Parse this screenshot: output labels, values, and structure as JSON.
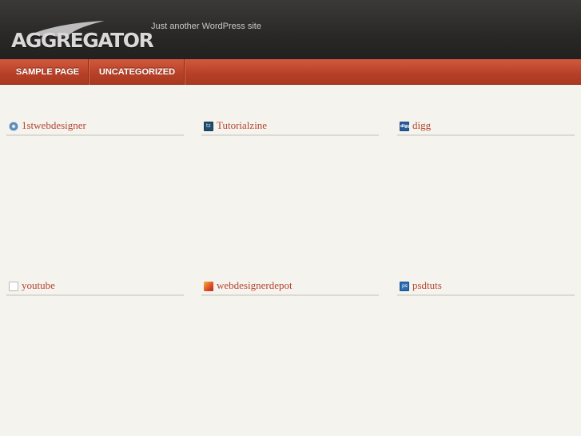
{
  "header": {
    "logo_text": "AGGREGATOR",
    "tagline": "Just another WordPress site"
  },
  "nav": {
    "items": [
      {
        "label": "SAMPLE PAGE"
      },
      {
        "label": "UNCATEGORIZED"
      }
    ]
  },
  "feeds": [
    {
      "title": "1stwebdesigner",
      "icon": "1stwebdesigner-icon"
    },
    {
      "title": "Tutorialzine",
      "icon": "tutorialzine-icon"
    },
    {
      "title": "digg",
      "icon": "digg-icon"
    },
    {
      "title": "youtube",
      "icon": "youtube-icon"
    },
    {
      "title": "webdesignerdepot",
      "icon": "webdesignerdepot-icon"
    },
    {
      "title": "psdtuts",
      "icon": "psdtuts-icon"
    }
  ],
  "colors": {
    "accent": "#b5442c",
    "nav": "#c04a30",
    "header": "#2a2827",
    "background": "#f5f3ee"
  }
}
